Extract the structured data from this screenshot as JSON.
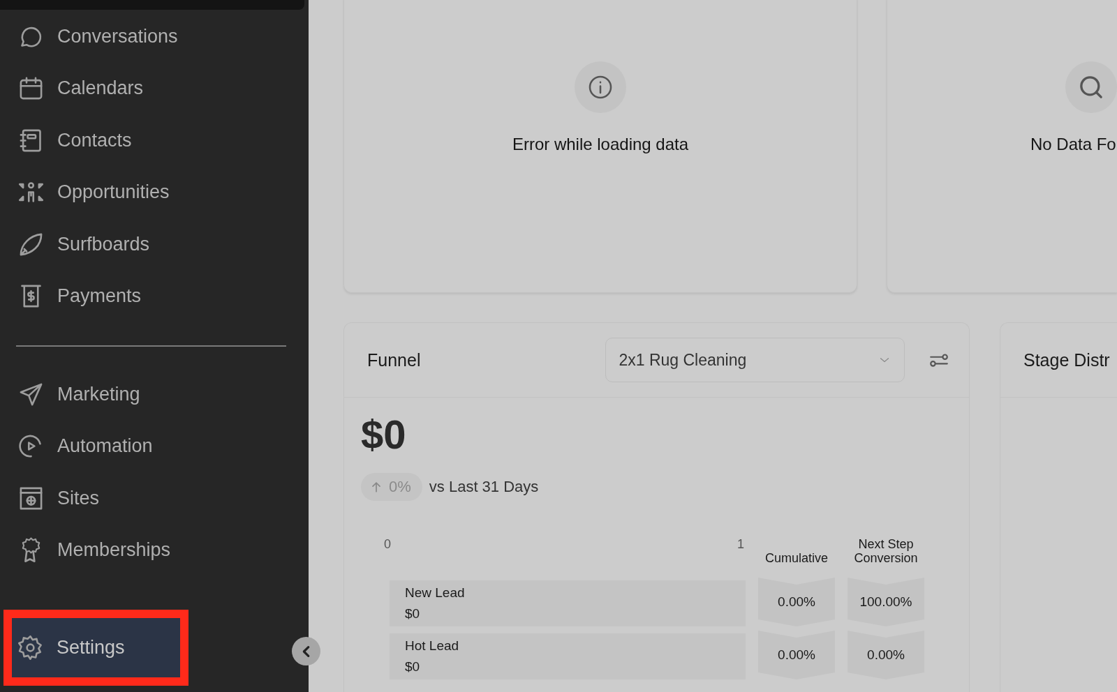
{
  "sidebar": {
    "sections": [
      {
        "items": [
          {
            "label": "Conversations",
            "selected": false,
            "highlighted": false
          },
          {
            "label": "Calendars",
            "selected": false,
            "highlighted": false
          },
          {
            "label": "Contacts",
            "selected": false,
            "highlighted": false
          },
          {
            "label": "Opportunities",
            "selected": false,
            "highlighted": false
          },
          {
            "label": "Surfboards",
            "selected": false,
            "highlighted": false
          },
          {
            "label": "Payments",
            "selected": false,
            "highlighted": false
          }
        ]
      },
      {
        "items": [
          {
            "label": "Marketing",
            "selected": false,
            "highlighted": false
          },
          {
            "label": "Automation",
            "selected": false,
            "highlighted": false
          },
          {
            "label": "Sites",
            "selected": false,
            "highlighted": false
          },
          {
            "label": "Memberships",
            "selected": false,
            "highlighted": false
          }
        ]
      },
      {
        "items": [
          {
            "label": "Settings",
            "selected": true,
            "highlighted": true
          }
        ]
      }
    ]
  },
  "status_cards": [
    {
      "kind": "error",
      "message": "Error while loading data"
    },
    {
      "kind": "empty",
      "message": "No Data Fo"
    }
  ],
  "funnel": {
    "title": "Funnel",
    "pipeline_select": {
      "value": "2x1 Rug Cleaning"
    },
    "total": "$0",
    "change": {
      "value": "0%",
      "caption": "vs Last 31 Days"
    },
    "axis_labels": [
      "0",
      "1"
    ],
    "columns": [
      "Cumulative",
      "Next Step Conversion"
    ],
    "rows": [
      {
        "stage": "New Lead",
        "value": "$0",
        "cumulative": "0.00%",
        "next_step": "100.00%"
      },
      {
        "stage": "Hot Lead",
        "value": "$0",
        "cumulative": "0.00%",
        "next_step": "0.00%"
      }
    ]
  },
  "stage_distribution": {
    "title": "Stage Distr"
  }
}
